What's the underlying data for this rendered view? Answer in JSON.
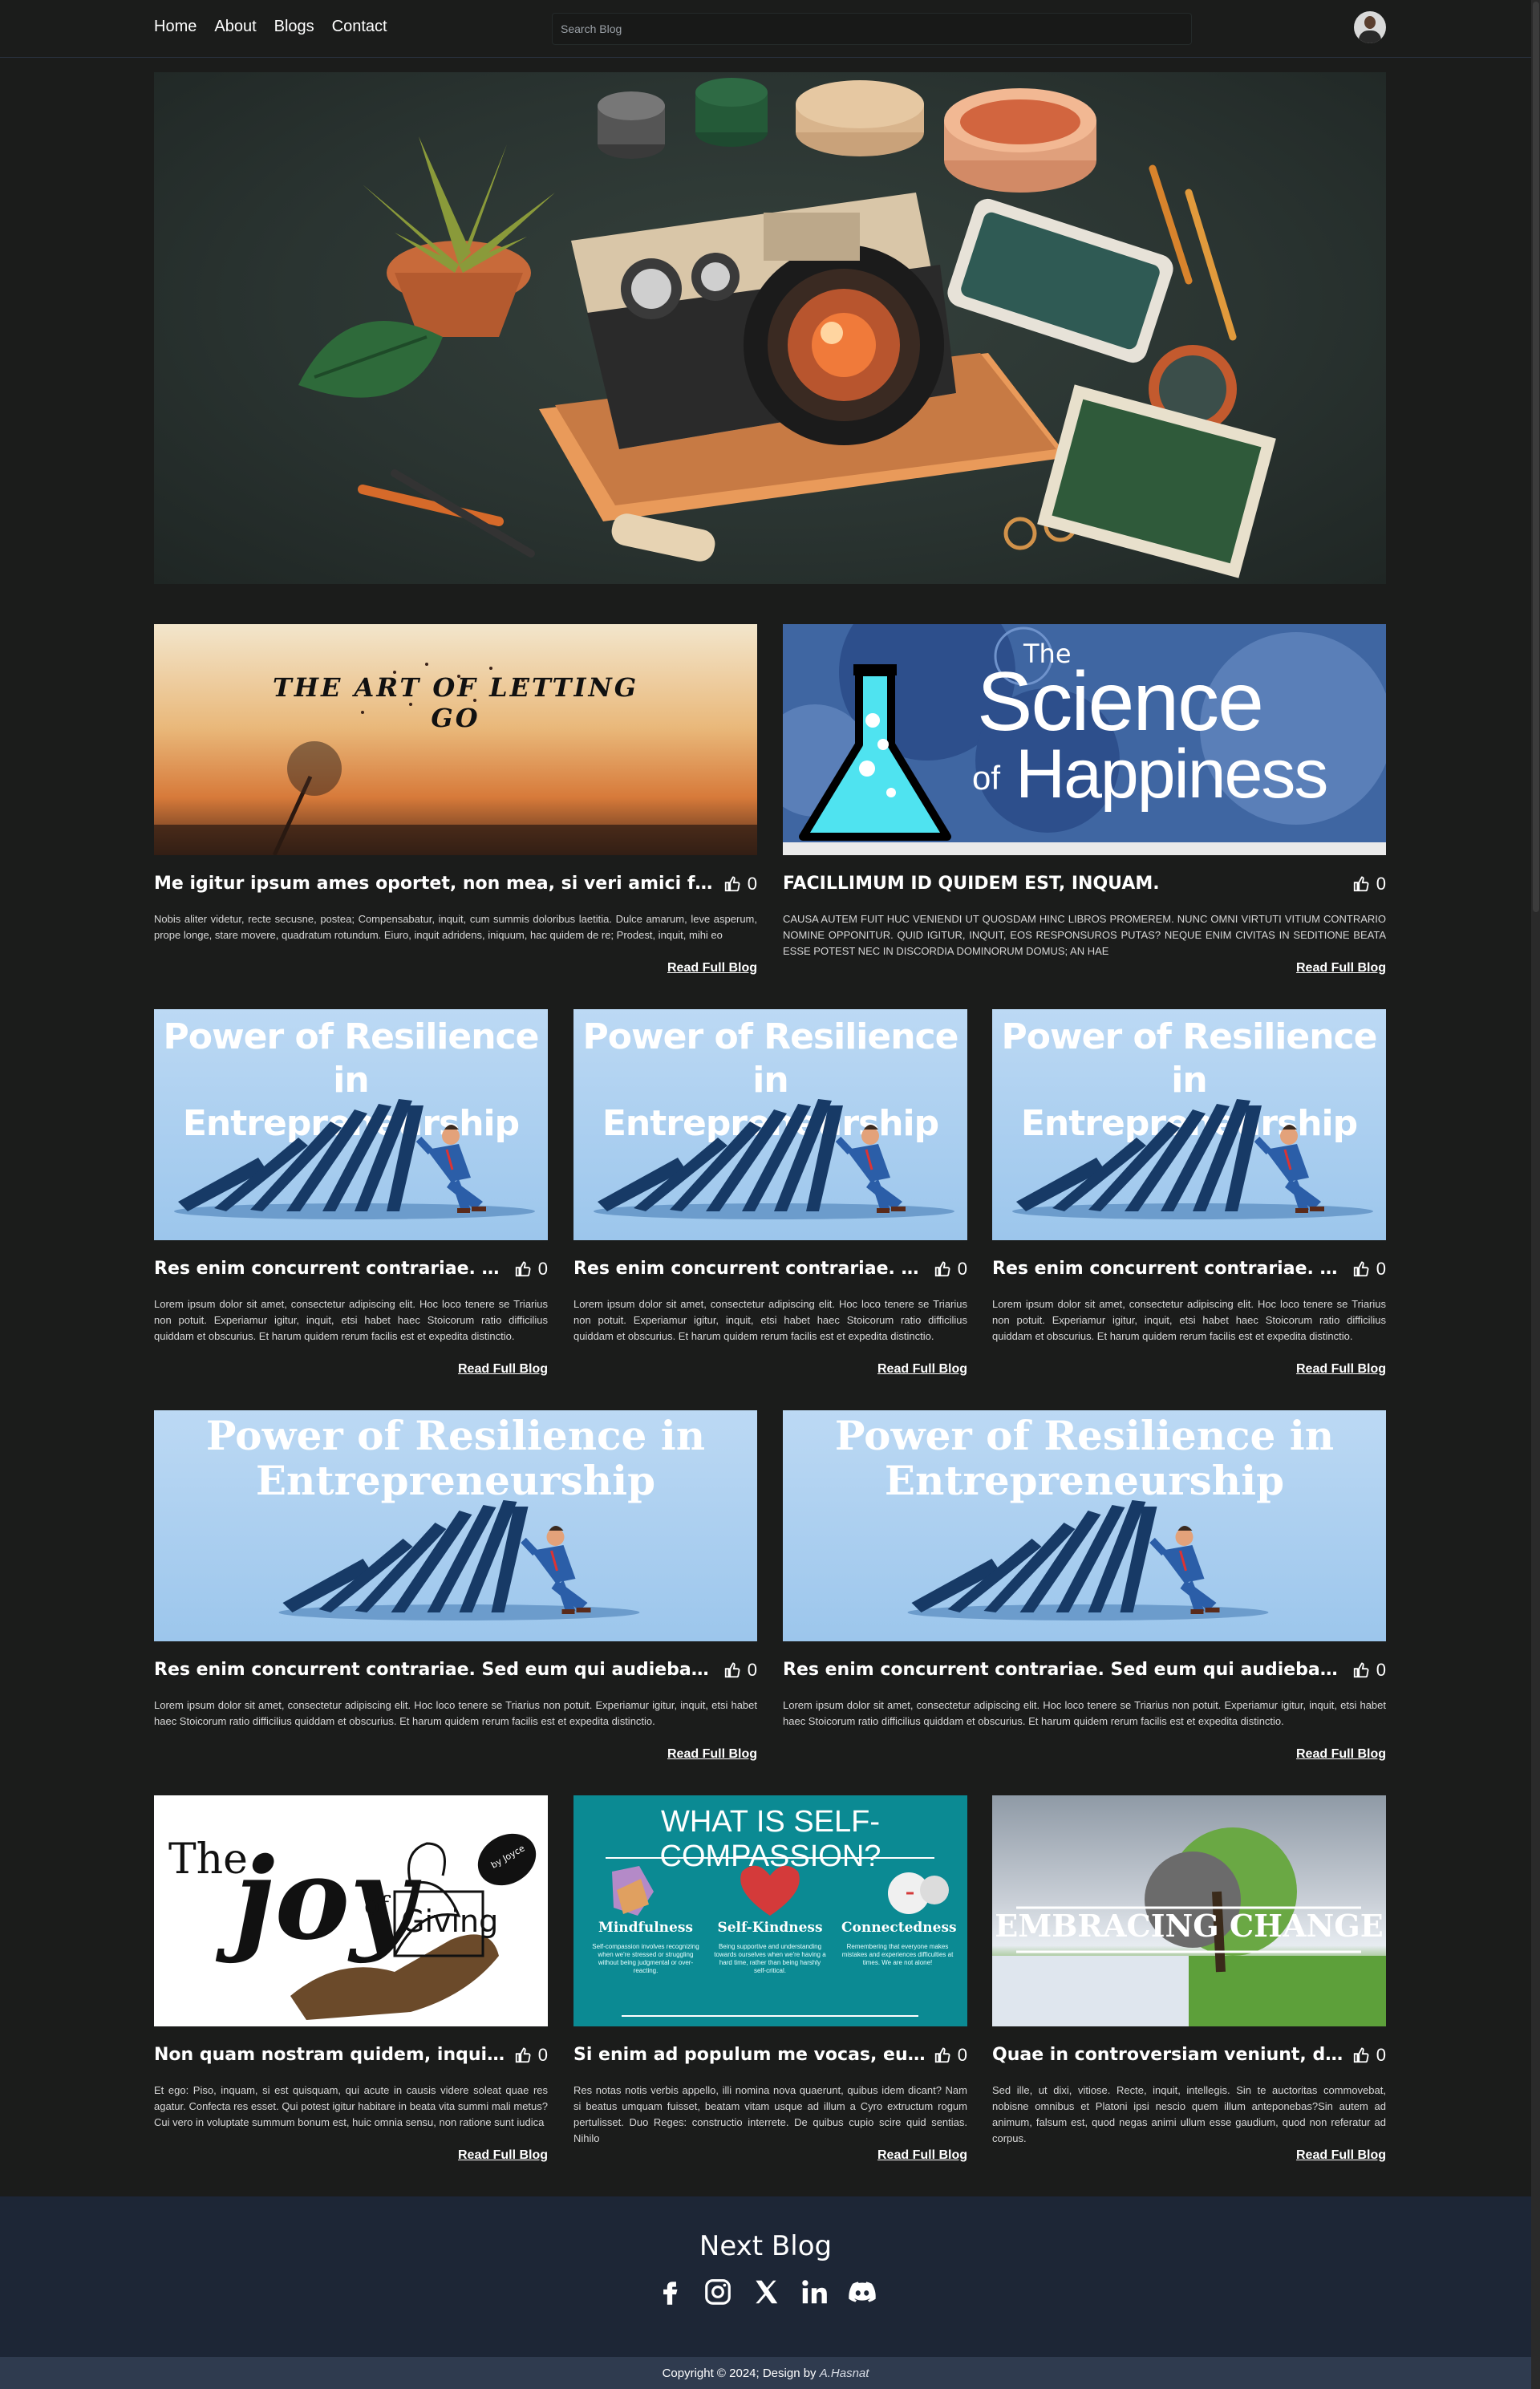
{
  "nav": {
    "links": [
      "Home",
      "About",
      "Blogs",
      "Contact"
    ],
    "search_placeholder": "Search Blog"
  },
  "cards": [
    {
      "image": "The art of letting go",
      "title": "Me igitur ipsum ames oportet, non mea, si veri amici futuri...",
      "likes": "0",
      "text": "Nobis aliter videtur, recte secusne, postea; Compensabatur, inquit, cum summis doloribus laetitia. Dulce amarum, leve asperum, prope longe, stare movere, quadratum rotundum. Eiuro, inquit adridens, iniquum, hac quidem de re; Prodest, inquit, mihi eo",
      "read": "Read Full Blog"
    },
    {
      "image": "The Science of Happiness",
      "title": "FACILLIMUM ID QUIDEM EST, INQUAM.",
      "likes": "0",
      "text": "CAUSA AUTEM FUIT HUC VENIENDI UT QUOSDAM HINC LIBROS PROMEREM. NUNC OMNI VIRTUTI VITIUM CONTRARIO NOMINE OPPONITUR. QUID IGITUR, INQUIT, EOS RESPONSUROS PUTAS? NEQUE ENIM CIVITAS IN SEDITIONE BEATA ESSE POTEST NEC IN DISCORDIA DOMINORUM DOMUS; AN HAE",
      "read": "Read Full Blog"
    },
    {
      "image": "Power of Resilience in Entrepreneurship",
      "title": "Res enim concurrent contrariae. Se...",
      "likes": "0",
      "text": "Lorem ipsum dolor sit amet, consectetur adipiscing elit. Hoc loco tenere se Triarius non potuit. Experiamur igitur, inquit, etsi habet haec Stoicorum ratio difficilius quiddam et obscurius. Et harum quidem rerum facilis est et expedita distinctio.",
      "read": "Read Full Blog"
    },
    {
      "image": "Power of Resilience in Entrepreneurship",
      "title": "Res enim concurrent contrariae. Se...",
      "likes": "0",
      "text": "Lorem ipsum dolor sit amet, consectetur adipiscing elit. Hoc loco tenere se Triarius non potuit. Experiamur igitur, inquit, etsi habet haec Stoicorum ratio difficilius quiddam et obscurius. Et harum quidem rerum facilis est et expedita distinctio.",
      "read": "Read Full Blog"
    },
    {
      "image": "Power of Resilience in Entrepreneurship",
      "title": "Res enim concurrent contrariae. Se...",
      "likes": "0",
      "text": "Lorem ipsum dolor sit amet, consectetur adipiscing elit. Hoc loco tenere se Triarius non potuit. Experiamur igitur, inquit, etsi habet haec Stoicorum ratio difficilius quiddam et obscurius. Et harum quidem rerum facilis est et expedita distinctio.",
      "read": "Read Full Blog"
    },
    {
      "image": "Power of Resilience in Entrepreneurship",
      "title": "Res enim concurrent contrariae. Sed eum qui audiebant,",
      "likes": "0",
      "text": "Lorem ipsum dolor sit amet, consectetur adipiscing elit. Hoc loco tenere se Triarius non potuit. Experiamur igitur, inquit, etsi habet haec Stoicorum ratio difficilius quiddam et obscurius. Et harum quidem rerum facilis est et expedita distinctio.",
      "read": "Read Full Blog"
    },
    {
      "image": "Power of Resilience in Entrepreneurship",
      "title": "Res enim concurrent contrariae. Sed eum qui audiebant,",
      "likes": "0",
      "text": "Lorem ipsum dolor sit amet, consectetur adipiscing elit. Hoc loco tenere se Triarius non potuit. Experiamur igitur, inquit, etsi habet haec Stoicorum ratio difficilius quiddam et obscurius. Et harum quidem rerum facilis est et expedita distinctio.",
      "read": "Read Full Blog"
    },
    {
      "image": "The joy of Giving",
      "title": "Non quam nostram quidem, inquit...",
      "likes": "0",
      "text": "Et ego: Piso, inquam, si est quisquam, qui acute in causis videre soleat quae res agatur. Confecta res esset. Qui potest igitur habitare in beata vita summi mali metus? Cui vero in voluptate summum bonum est, huic omnia sensu, non ratione sunt iudica",
      "read": "Read Full Blog"
    },
    {
      "image": "What is self-compassion?",
      "title": "Si enim ad populum me vocas, eum.",
      "likes": "0",
      "text": "Res notas notis verbis appello, illi nomina nova quaerunt, quibus idem dicant? Nam si beatus umquam fuisset, beatam vitam usque ad illum a Cyro extructum rogum pertulisset. Duo Reges: constructio interrete. De quibus cupio scire quid sentias. Nihilo",
      "read": "Read Full Blog"
    },
    {
      "image": "Embracing change",
      "title": "Quae in controversiam veniunt, de ii...",
      "likes": "0",
      "text": "Sed ille, ut dixi, vitiose. Recte, inquit, intellegis. Sin te auctoritas commovebat, nobisne omnibus et Platoni ipsi nescio quem illum anteponebas?Sin autem ad animum, falsum est, quod negas animi ullum esse gaudium, quod non referatur ad corpus.",
      "read": "Read Full Blog"
    }
  ],
  "thumbs": {
    "letting_go": "The art of letting go",
    "science_the": "The",
    "science_line1": "Science",
    "science_of": "of",
    "science_line2": "Happiness",
    "resilience_line1": "Power of Resilience in",
    "resilience_line2": "Entrepreneurship",
    "joy_the": "The",
    "joy_joy": "joy",
    "joy_of": "of",
    "joy_giving": "Giving",
    "joy_by": "by Joyce",
    "compassion_title": "WHAT IS SELF-COMPASSION?",
    "compassion_c1": "Mindfulness",
    "compassion_c2": "Self-Kindness",
    "compassion_c3": "Connectedness",
    "compassion_d1": "Self-compassion involves recognizing when we're stressed or struggling without being judgmental or over-reacting.",
    "compassion_d2": "Being supportive and understanding towards ourselves when we're having a hard time, rather than being harshly self-critical.",
    "compassion_d3": "Remembering that everyone makes mistakes and experiences difficulties at times. We are not alone!",
    "change": "EMBRACING CHANGE"
  },
  "footer": {
    "next": "Next Blog",
    "socials": [
      "facebook-icon",
      "instagram-icon",
      "x-icon",
      "linkedin-icon",
      "discord-icon"
    ],
    "copyright": "Copyright © 2024; Design by",
    "author": "A.Hasnat"
  }
}
